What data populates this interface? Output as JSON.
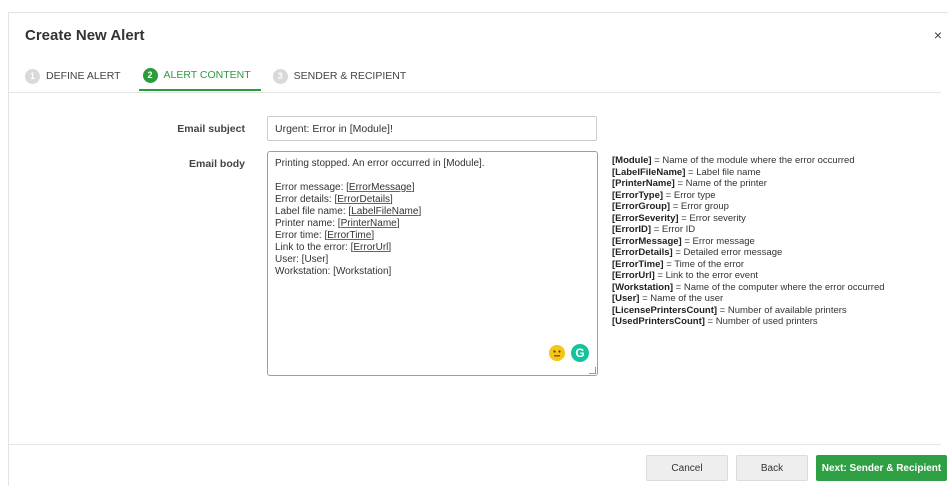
{
  "dialog": {
    "title": "Create New Alert",
    "close_glyph": "×"
  },
  "steps": [
    {
      "num": "1",
      "label": "DEFINE ALERT",
      "active": false
    },
    {
      "num": "2",
      "label": "ALERT CONTENT",
      "active": true
    },
    {
      "num": "3",
      "label": "SENDER & RECIPIENT",
      "active": false
    }
  ],
  "form": {
    "subject_label": "Email subject",
    "subject_value": "Urgent: Error in [Module]!",
    "body_label": "Email body",
    "body_lines": [
      {
        "prefix": "Printing stopped. An error occurred in [Module].",
        "token": "",
        "suffix": ""
      },
      {
        "prefix": "",
        "token": "",
        "suffix": ""
      },
      {
        "prefix": "Error message: [",
        "token": "ErrorMessage",
        "suffix": "]"
      },
      {
        "prefix": "Error details: [",
        "token": "ErrorDetails",
        "suffix": "]"
      },
      {
        "prefix": "Label file name: [",
        "token": "LabelFileName",
        "suffix": "]"
      },
      {
        "prefix": "Printer name: [",
        "token": "PrinterName",
        "suffix": "]"
      },
      {
        "prefix": "Error time: [",
        "token": "ErrorTime",
        "suffix": "]"
      },
      {
        "prefix": "Link to the error: [",
        "token": "ErrorUrl",
        "suffix": "]"
      },
      {
        "prefix": "User: [User]",
        "token": "",
        "suffix": ""
      },
      {
        "prefix": "Workstation: [Workstation]",
        "token": "",
        "suffix": ""
      }
    ],
    "grammarly_glyph": "G"
  },
  "legend": [
    {
      "key": "[Module]",
      "desc": " = Name of the module where the error occurred"
    },
    {
      "key": "[LabelFileName]",
      "desc": " = Label file name"
    },
    {
      "key": "[PrinterName]",
      "desc": " = Name of the printer"
    },
    {
      "key": "[ErrorType]",
      "desc": " = Error type"
    },
    {
      "key": "[ErrorGroup]",
      "desc": " = Error group"
    },
    {
      "key": "[ErrorSeverity]",
      "desc": " = Error severity"
    },
    {
      "key": "[ErrorID]",
      "desc": " = Error ID"
    },
    {
      "key": "[ErrorMessage]",
      "desc": " = Error message"
    },
    {
      "key": "[ErrorDetails]",
      "desc": " = Detailed error message"
    },
    {
      "key": "[ErrorTime]",
      "desc": " = Time of the error"
    },
    {
      "key": "[ErrorUrl]",
      "desc": " = Link to the error event"
    },
    {
      "key": "[Workstation]",
      "desc": " = Name of the computer where the error occurred"
    },
    {
      "key": "[User]",
      "desc": " = Name of the user"
    },
    {
      "key": "[LicensePrintersCount]",
      "desc": " = Number of available printers"
    },
    {
      "key": "[UsedPrintersCount]",
      "desc": " = Number of used printers"
    }
  ],
  "footer": {
    "cancel_label": "Cancel",
    "back_label": "Back",
    "next_label": "Next: Sender & Recipient"
  },
  "colors": {
    "accent": "#2a9d3a",
    "focus_border": "#5ec28a",
    "grammarly": "#15c39a"
  }
}
